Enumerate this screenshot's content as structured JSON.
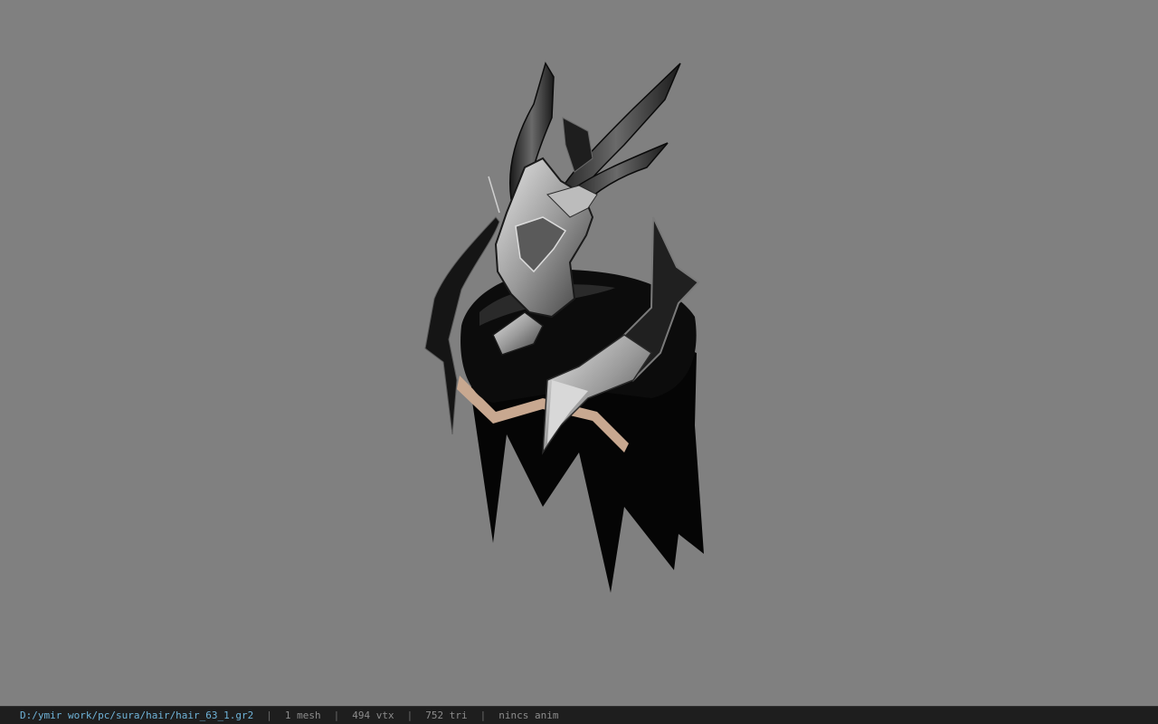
{
  "viewport": {
    "background_color": "#808080",
    "model_icon": "hair-model-render"
  },
  "status": {
    "file_path": "D:/ymir work/pc/sura/hair/hair_63_1.gr2",
    "meshes": "1 mesh",
    "vertices": "494 vtx",
    "triangles": "752 tri",
    "animation": "nincs anim",
    "separator": "|",
    "path_color": "#6fb3d8"
  }
}
